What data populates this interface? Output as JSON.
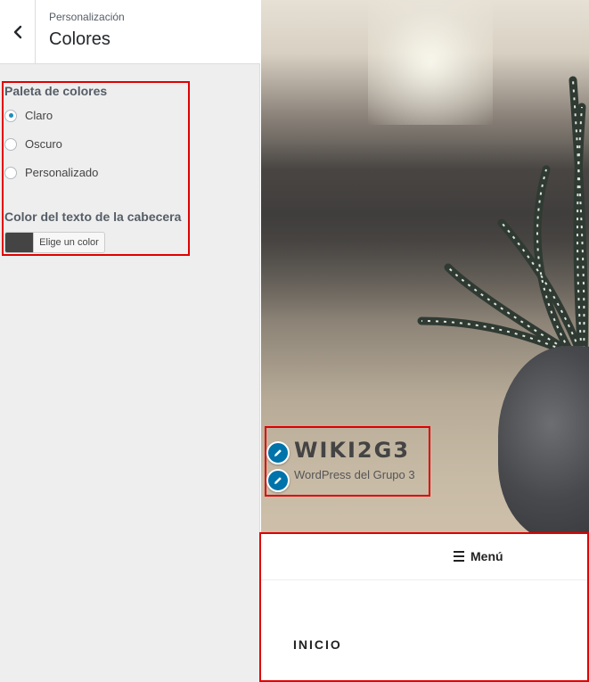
{
  "sidebar": {
    "breadcrumb": "Personalización",
    "title": "Colores",
    "palette": {
      "label": "Paleta de colores",
      "options": [
        {
          "label": "Claro",
          "checked": true
        },
        {
          "label": "Oscuro",
          "checked": false
        },
        {
          "label": "Personalizado",
          "checked": false
        }
      ]
    },
    "header_text_color": {
      "label": "Color del texto de la cabecera",
      "button_label": "Elige un color",
      "current_color": "#444444"
    }
  },
  "preview": {
    "site_title": "WIKI2G3",
    "site_description": "WordPress del Grupo 3",
    "menu_toggle_label": "Menú",
    "nav_items": [
      "INICIO"
    ]
  },
  "colors": {
    "highlight": "#e00000",
    "accent": "#0073aa",
    "radio_accent": "#1e8cbe"
  }
}
